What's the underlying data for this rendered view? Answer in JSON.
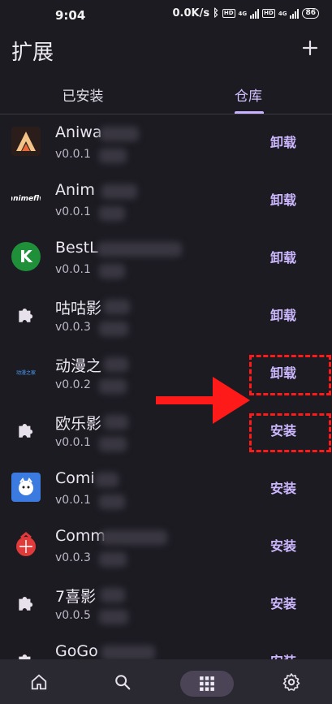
{
  "status": {
    "time": "9:04",
    "speed": "0.0K/s",
    "battery": "86",
    "net1": "4G",
    "net2": "4G",
    "hd": "HD"
  },
  "header": {
    "title": "扩展"
  },
  "tabs": [
    {
      "label": "已安装"
    },
    {
      "label": "仓库"
    }
  ],
  "extensions": [
    {
      "name": "Aniwa",
      "version": "v0.0.1",
      "action": "卸载",
      "icon": "aniwave-logo"
    },
    {
      "name": "Anim",
      "version": "v0.0.1",
      "action": "卸载",
      "icon": "animeflv-logo",
      "icon_text": "animeflv"
    },
    {
      "name": "BestL",
      "version": "v0.0.1",
      "action": "卸载",
      "icon": "green-k-logo",
      "icon_text": "K"
    },
    {
      "name": "咕咕影",
      "version": "v0.0.3",
      "action": "卸载",
      "icon": "puzzle-icon"
    },
    {
      "name": "动漫之",
      "version": "v0.0.2",
      "action": "卸载",
      "icon": "dongman-logo",
      "icon_text": "动漫之家"
    },
    {
      "name": "欧乐影",
      "version": "v0.0.1",
      "action": "安装",
      "icon": "puzzle-icon"
    },
    {
      "name": "Comi",
      "version": "v0.0.1",
      "action": "安装",
      "icon": "comic-logo"
    },
    {
      "name": "Comm",
      "version": "v0.0.3",
      "action": "安装",
      "icon": "red-ornament-logo"
    },
    {
      "name": "7喜影",
      "version": "v0.0.5",
      "action": "安装",
      "icon": "puzzle-icon"
    },
    {
      "name": "GoGo",
      "version": "",
      "action": "安装",
      "icon": "puzzle-icon"
    }
  ],
  "nav": [
    {
      "icon": "home-icon"
    },
    {
      "icon": "search-icon"
    },
    {
      "icon": "grid-icon"
    },
    {
      "icon": "gear-icon"
    }
  ],
  "colors": {
    "background": "#1c1b22",
    "accent": "#cdb8ff",
    "annotation": "#ff1a1a"
  }
}
